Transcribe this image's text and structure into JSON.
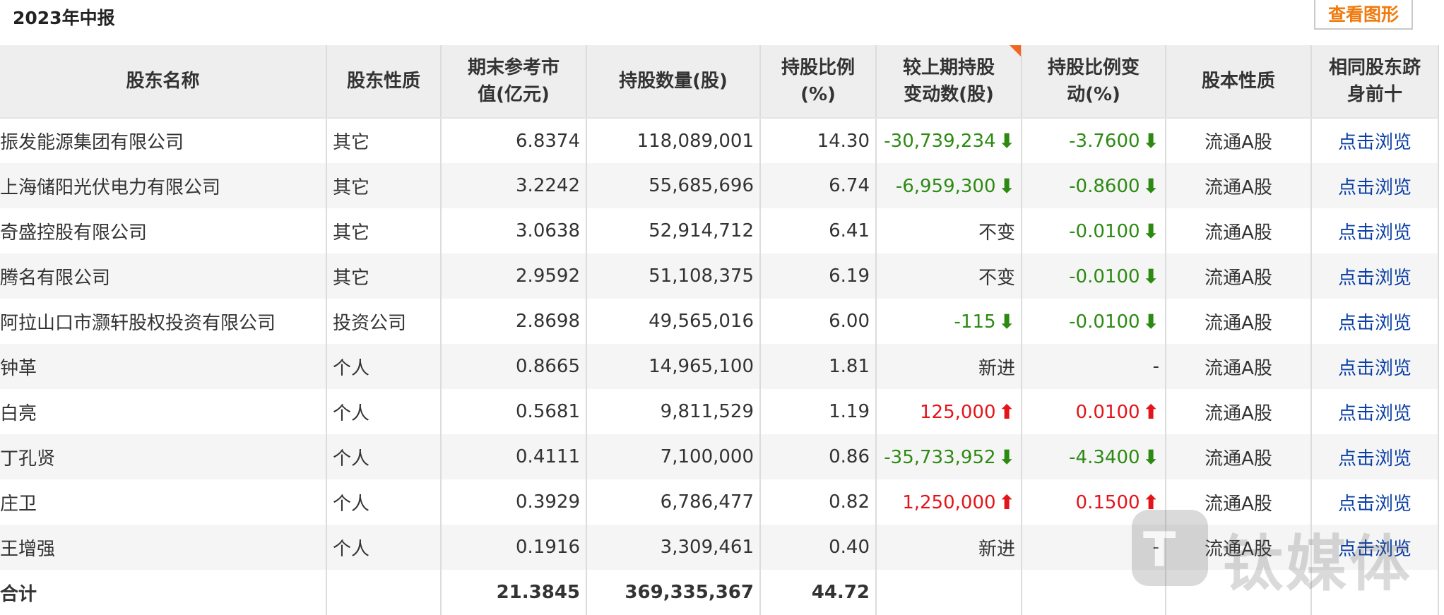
{
  "header": {
    "title": "2023年中报",
    "chart_button": "查看图形"
  },
  "table": {
    "columns": [
      {
        "line1": "股东名称",
        "line2": ""
      },
      {
        "line1": "股东性质",
        "line2": ""
      },
      {
        "line1": "期末参考市",
        "line2": "值(亿元)"
      },
      {
        "line1": "持股数量(股)",
        "line2": ""
      },
      {
        "line1": "持股比例",
        "line2": "(%)"
      },
      {
        "line1": "较上期持股",
        "line2": "变动数(股)"
      },
      {
        "line1": "持股比例变",
        "line2": "动(%)"
      },
      {
        "line1": "股本性质",
        "line2": ""
      },
      {
        "line1": "相同股东跻",
        "line2": "身前十"
      }
    ],
    "rows": [
      {
        "name": "振发能源集团有限公司",
        "type": "其它",
        "value": "6.8374",
        "shares": "118,089,001",
        "ratio": "14.30",
        "change": "-30,739,234",
        "change_dir": "down",
        "ratio_change": "-3.7600",
        "ratio_dir": "down",
        "nature": "流通A股",
        "link": "点击浏览"
      },
      {
        "name": "上海储阳光伏电力有限公司",
        "type": "其它",
        "value": "3.2242",
        "shares": "55,685,696",
        "ratio": "6.74",
        "change": "-6,959,300",
        "change_dir": "down",
        "ratio_change": "-0.8600",
        "ratio_dir": "down",
        "nature": "流通A股",
        "link": "点击浏览"
      },
      {
        "name": "奇盛控股有限公司",
        "type": "其它",
        "value": "3.0638",
        "shares": "52,914,712",
        "ratio": "6.41",
        "change": "不变",
        "change_dir": "none",
        "ratio_change": "-0.0100",
        "ratio_dir": "down",
        "nature": "流通A股",
        "link": "点击浏览"
      },
      {
        "name": "腾名有限公司",
        "type": "其它",
        "value": "2.9592",
        "shares": "51,108,375",
        "ratio": "6.19",
        "change": "不变",
        "change_dir": "none",
        "ratio_change": "-0.0100",
        "ratio_dir": "down",
        "nature": "流通A股",
        "link": "点击浏览"
      },
      {
        "name": "阿拉山口市灏轩股权投资有限公司",
        "type": "投资公司",
        "value": "2.8698",
        "shares": "49,565,016",
        "ratio": "6.00",
        "change": "-115",
        "change_dir": "down",
        "ratio_change": "-0.0100",
        "ratio_dir": "down",
        "nature": "流通A股",
        "link": "点击浏览"
      },
      {
        "name": "钟革",
        "type": "个人",
        "value": "0.8665",
        "shares": "14,965,100",
        "ratio": "1.81",
        "change": "新进",
        "change_dir": "none",
        "ratio_change": "-",
        "ratio_dir": "none",
        "nature": "流通A股",
        "link": "点击浏览"
      },
      {
        "name": "白亮",
        "type": "个人",
        "value": "0.5681",
        "shares": "9,811,529",
        "ratio": "1.19",
        "change": "125,000",
        "change_dir": "up",
        "ratio_change": "0.0100",
        "ratio_dir": "up",
        "nature": "流通A股",
        "link": "点击浏览"
      },
      {
        "name": "丁孔贤",
        "type": "个人",
        "value": "0.4111",
        "shares": "7,100,000",
        "ratio": "0.86",
        "change": "-35,733,952",
        "change_dir": "down",
        "ratio_change": "-4.3400",
        "ratio_dir": "down",
        "nature": "流通A股",
        "link": "点击浏览"
      },
      {
        "name": "庄卫",
        "type": "个人",
        "value": "0.3929",
        "shares": "6,786,477",
        "ratio": "0.82",
        "change": "1,250,000",
        "change_dir": "up",
        "ratio_change": "0.1500",
        "ratio_dir": "up",
        "nature": "流通A股",
        "link": "点击浏览"
      },
      {
        "name": "王增强",
        "type": "个人",
        "value": "0.1916",
        "shares": "3,309,461",
        "ratio": "0.40",
        "change": "新进",
        "change_dir": "none",
        "ratio_change": "-",
        "ratio_dir": "none",
        "nature": "流通A股",
        "link": "点击浏览"
      }
    ],
    "total": {
      "label": "合计",
      "value": "21.3845",
      "shares": "369,335,367",
      "ratio": "44.72"
    }
  },
  "watermark": {
    "text": "钛媒体",
    "logo_glyph": "T"
  },
  "colors": {
    "decrease": "#2c8a12",
    "increase": "#e3141a",
    "link": "#0b3fa6",
    "button_text": "#f07a0c",
    "header_bg": "#eeeeee"
  },
  "icons": {
    "down": "down-arrow-icon",
    "up": "up-arrow-icon"
  }
}
